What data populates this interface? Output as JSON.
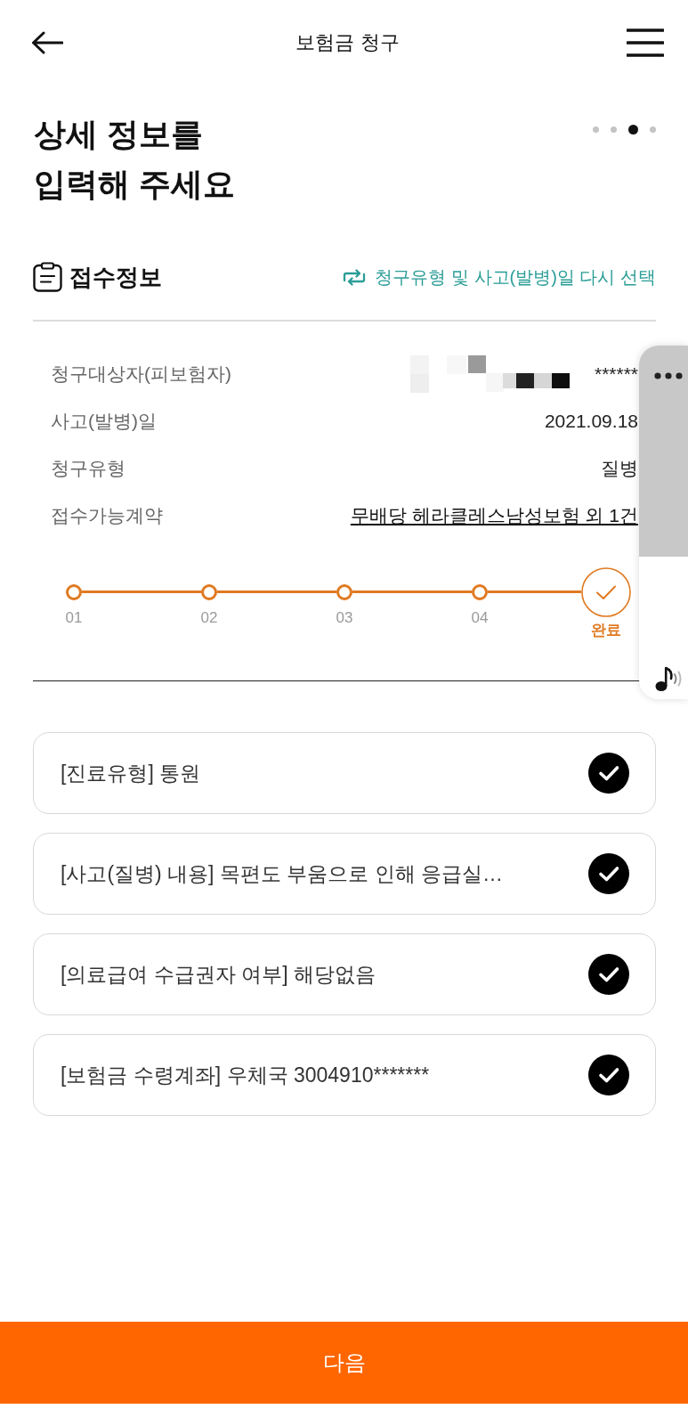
{
  "header": {
    "title": "보험금 청구"
  },
  "heading": "상세 정보를\n입력해 주세요",
  "page_indicator": [
    {
      "selected": false
    },
    {
      "selected": false
    },
    {
      "selected": true
    },
    {
      "selected": false
    }
  ],
  "section": {
    "title": "접수정보",
    "action": "청구유형 및 사고(발병)일 다시 선택"
  },
  "info_rows": [
    {
      "label": "청구대상자(피보험자)",
      "value": "******",
      "kind": "masked"
    },
    {
      "label": "사고(발병)일",
      "value": "2021.09.18",
      "kind": "text"
    },
    {
      "label": "청구유형",
      "value": "질병",
      "kind": "text"
    },
    {
      "label": "접수가능계약",
      "value": "무배당 헤라클레스남성보험 외 1건",
      "kind": "link"
    }
  ],
  "steps": [
    {
      "label": "01",
      "kind": "dot"
    },
    {
      "label": "02",
      "kind": "dot"
    },
    {
      "label": "03",
      "kind": "dot"
    },
    {
      "label": "04",
      "kind": "dot"
    },
    {
      "label": "완료",
      "kind": "check"
    }
  ],
  "items": [
    {
      "text": "[진료유형] 통원",
      "checked": true
    },
    {
      "text": "[사고(질병) 내용] 목편도 부움으로 인해 응급실…",
      "checked": true
    },
    {
      "text": "[의료급여 수급권자 여부] 해당없음",
      "checked": true
    },
    {
      "text": "[보험금 수령계좌] 우체국 3004910*******",
      "checked": true
    }
  ],
  "next_button": {
    "label": "다음"
  }
}
